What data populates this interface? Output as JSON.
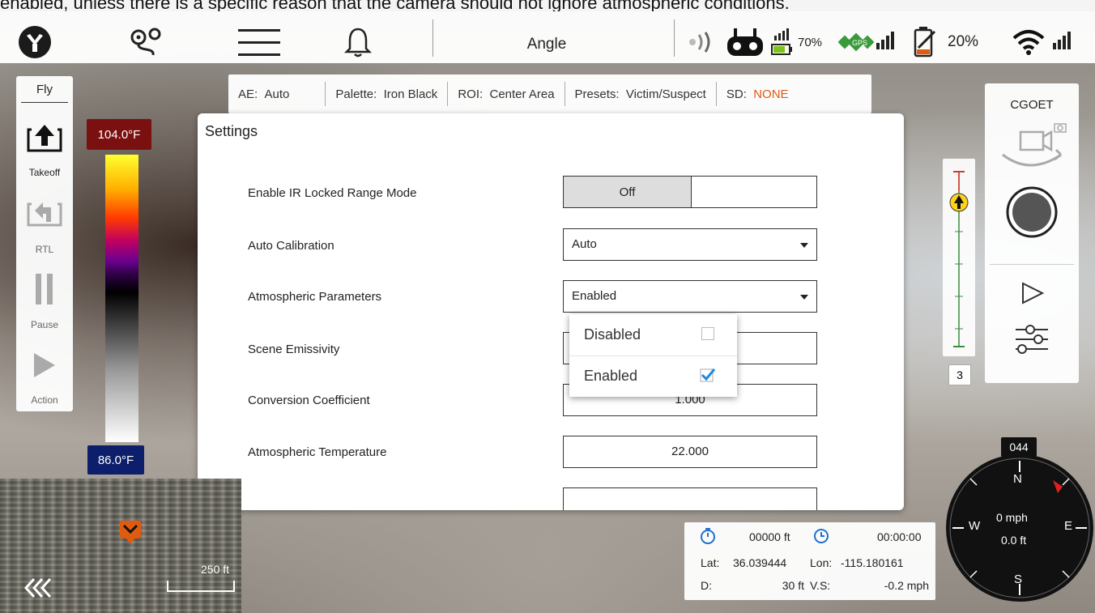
{
  "caption_text": "enabled, unless there is a specific reason that the camera should not ignore atmospheric conditions.",
  "topbar": {
    "mode_label": "Angle",
    "rc_signal_battery": "70%",
    "gps_label": "GPS",
    "device_battery": "20%"
  },
  "flight_panel": {
    "tab": "Fly",
    "takeoff": "Takeoff",
    "rtl": "RTL",
    "pause": "Pause",
    "action": "Action"
  },
  "temp_scale": {
    "max": "104.0°F",
    "min": "86.0°F"
  },
  "info_strip": {
    "ae_key": "AE:",
    "ae_val": "Auto",
    "palette_key": "Palette:",
    "palette_val": "Iron Black",
    "roi_key": "ROI:",
    "roi_val": "Center Area",
    "presets_key": "Presets:",
    "presets_val": "Victim/Suspect",
    "sd_key": "SD:",
    "sd_val": "NONE"
  },
  "settings": {
    "title": "Settings",
    "rows": {
      "ir_locked": {
        "label": "Enable IR Locked Range Mode",
        "value": "Off"
      },
      "auto_cal": {
        "label": "Auto Calibration",
        "value": "Auto"
      },
      "atmos": {
        "label": "Atmospheric Parameters",
        "value": "Enabled"
      },
      "emissivity": {
        "label": "Scene Emissivity"
      },
      "conversion": {
        "label": "Conversion Coefficient",
        "value": "1.000"
      },
      "atmos_temp": {
        "label": "Atmospheric Temperature",
        "value": "22.000"
      }
    },
    "popup": {
      "options": [
        {
          "label": "Disabled",
          "checked": false
        },
        {
          "label": "Enabled",
          "checked": true
        }
      ]
    }
  },
  "right_panel": {
    "camera_name": "CGOET"
  },
  "gimbal": {
    "value": "3"
  },
  "compass": {
    "heading": "044",
    "n": "N",
    "s": "S",
    "e": "E",
    "w": "W",
    "speed": "0 mph",
    "alt": "0.0 ft"
  },
  "telemetry": {
    "dist_val": "00000 ft",
    "time_val": "00:00:00",
    "lat_key": "Lat:",
    "lat_val": "36.039444",
    "lon_key": "Lon:",
    "lon_val": "-115.180161",
    "d_key": "D:",
    "d_val": "30 ft",
    "vs_key": "V.S:",
    "vs_val": "-0.2 mph"
  },
  "minimap": {
    "scale": "250 ft"
  },
  "colors": {
    "accent_orange": "#e05a10",
    "sd_none": "#e05a10",
    "temp_max_bg": "#7b1010",
    "temp_min_bg": "#0d1f6a",
    "check_blue": "#1e88e5"
  }
}
